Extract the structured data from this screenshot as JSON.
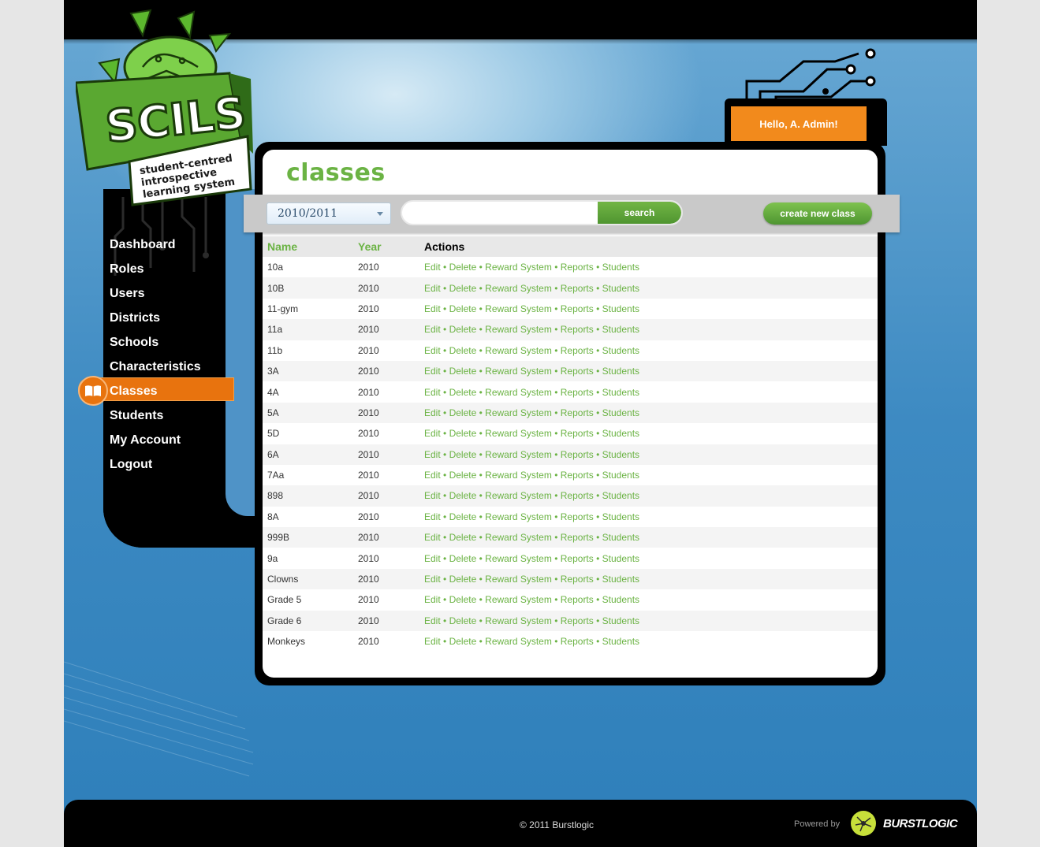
{
  "logo": {
    "name": "SCILS",
    "tagline_1": "student-centred",
    "tagline_2": "introspective",
    "tagline_3": "learning system"
  },
  "greeting": "Hello, A. Admin!",
  "nav": {
    "items": [
      {
        "label": "Dashboard",
        "active": false
      },
      {
        "label": "Roles",
        "active": false
      },
      {
        "label": "Users",
        "active": false
      },
      {
        "label": "Districts",
        "active": false
      },
      {
        "label": "Schools",
        "active": false
      },
      {
        "label": "Characteristics",
        "active": false
      },
      {
        "label": "Classes",
        "active": true
      },
      {
        "label": "Students",
        "active": false
      },
      {
        "label": "My Account",
        "active": false
      },
      {
        "label": "Logout",
        "active": false
      }
    ]
  },
  "page_title": "classes",
  "toolbar": {
    "year_selected": "2010/2011",
    "search_value": "",
    "search_label": "search",
    "create_label": "create new class"
  },
  "table": {
    "headers": {
      "name": "Name",
      "year": "Year",
      "actions": "Actions"
    },
    "action_labels": [
      "Edit",
      "Delete",
      "Reward System",
      "Reports",
      "Students"
    ],
    "separator": "•",
    "rows": [
      {
        "name": "10a",
        "year": "2010"
      },
      {
        "name": "10B",
        "year": "2010"
      },
      {
        "name": "11-gym",
        "year": "2010"
      },
      {
        "name": "11a",
        "year": "2010"
      },
      {
        "name": "11b",
        "year": "2010"
      },
      {
        "name": "3A",
        "year": "2010"
      },
      {
        "name": "4A",
        "year": "2010"
      },
      {
        "name": "5A",
        "year": "2010"
      },
      {
        "name": "5D",
        "year": "2010"
      },
      {
        "name": "6A",
        "year": "2010"
      },
      {
        "name": "7Aa",
        "year": "2010"
      },
      {
        "name": "898",
        "year": "2010"
      },
      {
        "name": "8A",
        "year": "2010"
      },
      {
        "name": "999B",
        "year": "2010"
      },
      {
        "name": "9a",
        "year": "2010"
      },
      {
        "name": "Clowns",
        "year": "2010"
      },
      {
        "name": "Grade 5",
        "year": "2010"
      },
      {
        "name": "Grade 6",
        "year": "2010"
      },
      {
        "name": "Monkeys",
        "year": "2010"
      }
    ]
  },
  "footer": {
    "copyright": "© 2011 Burstlogic",
    "powered_by": "Powered by",
    "brand": "BURSTLOGIC"
  },
  "colors": {
    "accent_green": "#6bb344",
    "accent_orange": "#e8730e",
    "background_blue": "#3d8ac2"
  }
}
